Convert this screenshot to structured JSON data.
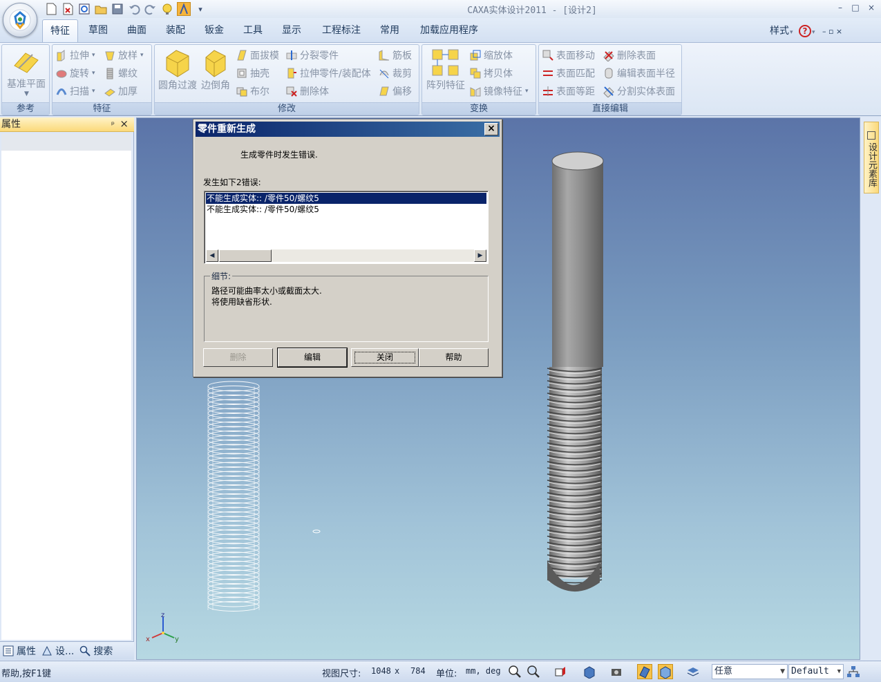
{
  "window": {
    "title": "CAXA实体设计2011 - [设计2]",
    "controls": {
      "minimize": "–",
      "restore": "□",
      "close": "×"
    }
  },
  "quick_access": {
    "icons": [
      "new-icon",
      "open-red-icon",
      "refresh-doc-icon",
      "folder-icon",
      "save-icon",
      "undo-icon",
      "redo-icon",
      "bulb-icon",
      "tool-icon"
    ],
    "overflow": "▾"
  },
  "tabs": [
    "特征",
    "草图",
    "曲面",
    "装配",
    "钣金",
    "工具",
    "显示",
    "工程标注",
    "常用",
    "加载应用程序"
  ],
  "active_tab": "特征",
  "style_menu": {
    "label": "样式",
    "help": "?",
    "mini_controls": "– ▫ ×"
  },
  "ribbon": {
    "reference": {
      "label": "参考",
      "big_button": "基准平面"
    },
    "features": {
      "label": "特征",
      "items": [
        "拉伸",
        "放样",
        "旋转",
        "螺纹",
        "扫描",
        "加厚"
      ]
    },
    "modify": {
      "label": "修改",
      "big_buttons": [
        "圆角过渡",
        "边倒角"
      ],
      "items": [
        "面拔模",
        "分裂零件",
        "筋板",
        "抽壳",
        "拉伸零件/装配体",
        "裁剪",
        "布尔",
        "删除体",
        "偏移"
      ]
    },
    "transform": {
      "label": "变换",
      "big_button": "阵列特征",
      "items": [
        "缩放体",
        "拷贝体",
        "镜像特征"
      ]
    },
    "direct_edit": {
      "label": "直接编辑",
      "items": [
        "表面移动",
        "删除表面",
        "表面匹配",
        "编辑表面半径",
        "表面等距",
        "分割实体表面"
      ]
    }
  },
  "left_panel": {
    "header": "属性",
    "pin": "ᵖ",
    "close": "×",
    "tabs": [
      "属性",
      "设...",
      "搜索"
    ]
  },
  "right_dock": {
    "tab": "设计元素库"
  },
  "dialog": {
    "title": "零件重新生成",
    "close": "×",
    "message": "生成零件时发生错误.",
    "list_label": "发生如下2错误:",
    "errors": [
      "不能生成实体:: /零件50/螺纹5",
      "不能生成实体:: /零件50/螺纹5"
    ],
    "selected_index": 0,
    "detail_legend": "细节:",
    "details": [
      "路径可能曲率太小或截面太大.",
      "将使用缺省形状."
    ],
    "buttons": {
      "delete": "删除",
      "edit": "编辑",
      "close": "关闭",
      "help": "帮助"
    }
  },
  "status": {
    "help": "帮助,按F1键",
    "view_size_label": "视图尺寸:",
    "view_size_w": "1048",
    "view_size_x": "x",
    "view_size_h": "784",
    "unit_label": "单位:",
    "units": "mm, deg",
    "combo_any": "任意",
    "combo_style": "Default"
  },
  "axis": {
    "x": "x",
    "y": "y",
    "z": "z"
  },
  "colors": {
    "ribbon_bg": "#dfe8f6",
    "dialog_title": "#0a246a",
    "selected_row": "#0a246a",
    "viewport_top": "#5b74a8",
    "viewport_bottom": "#b6d8e2"
  }
}
